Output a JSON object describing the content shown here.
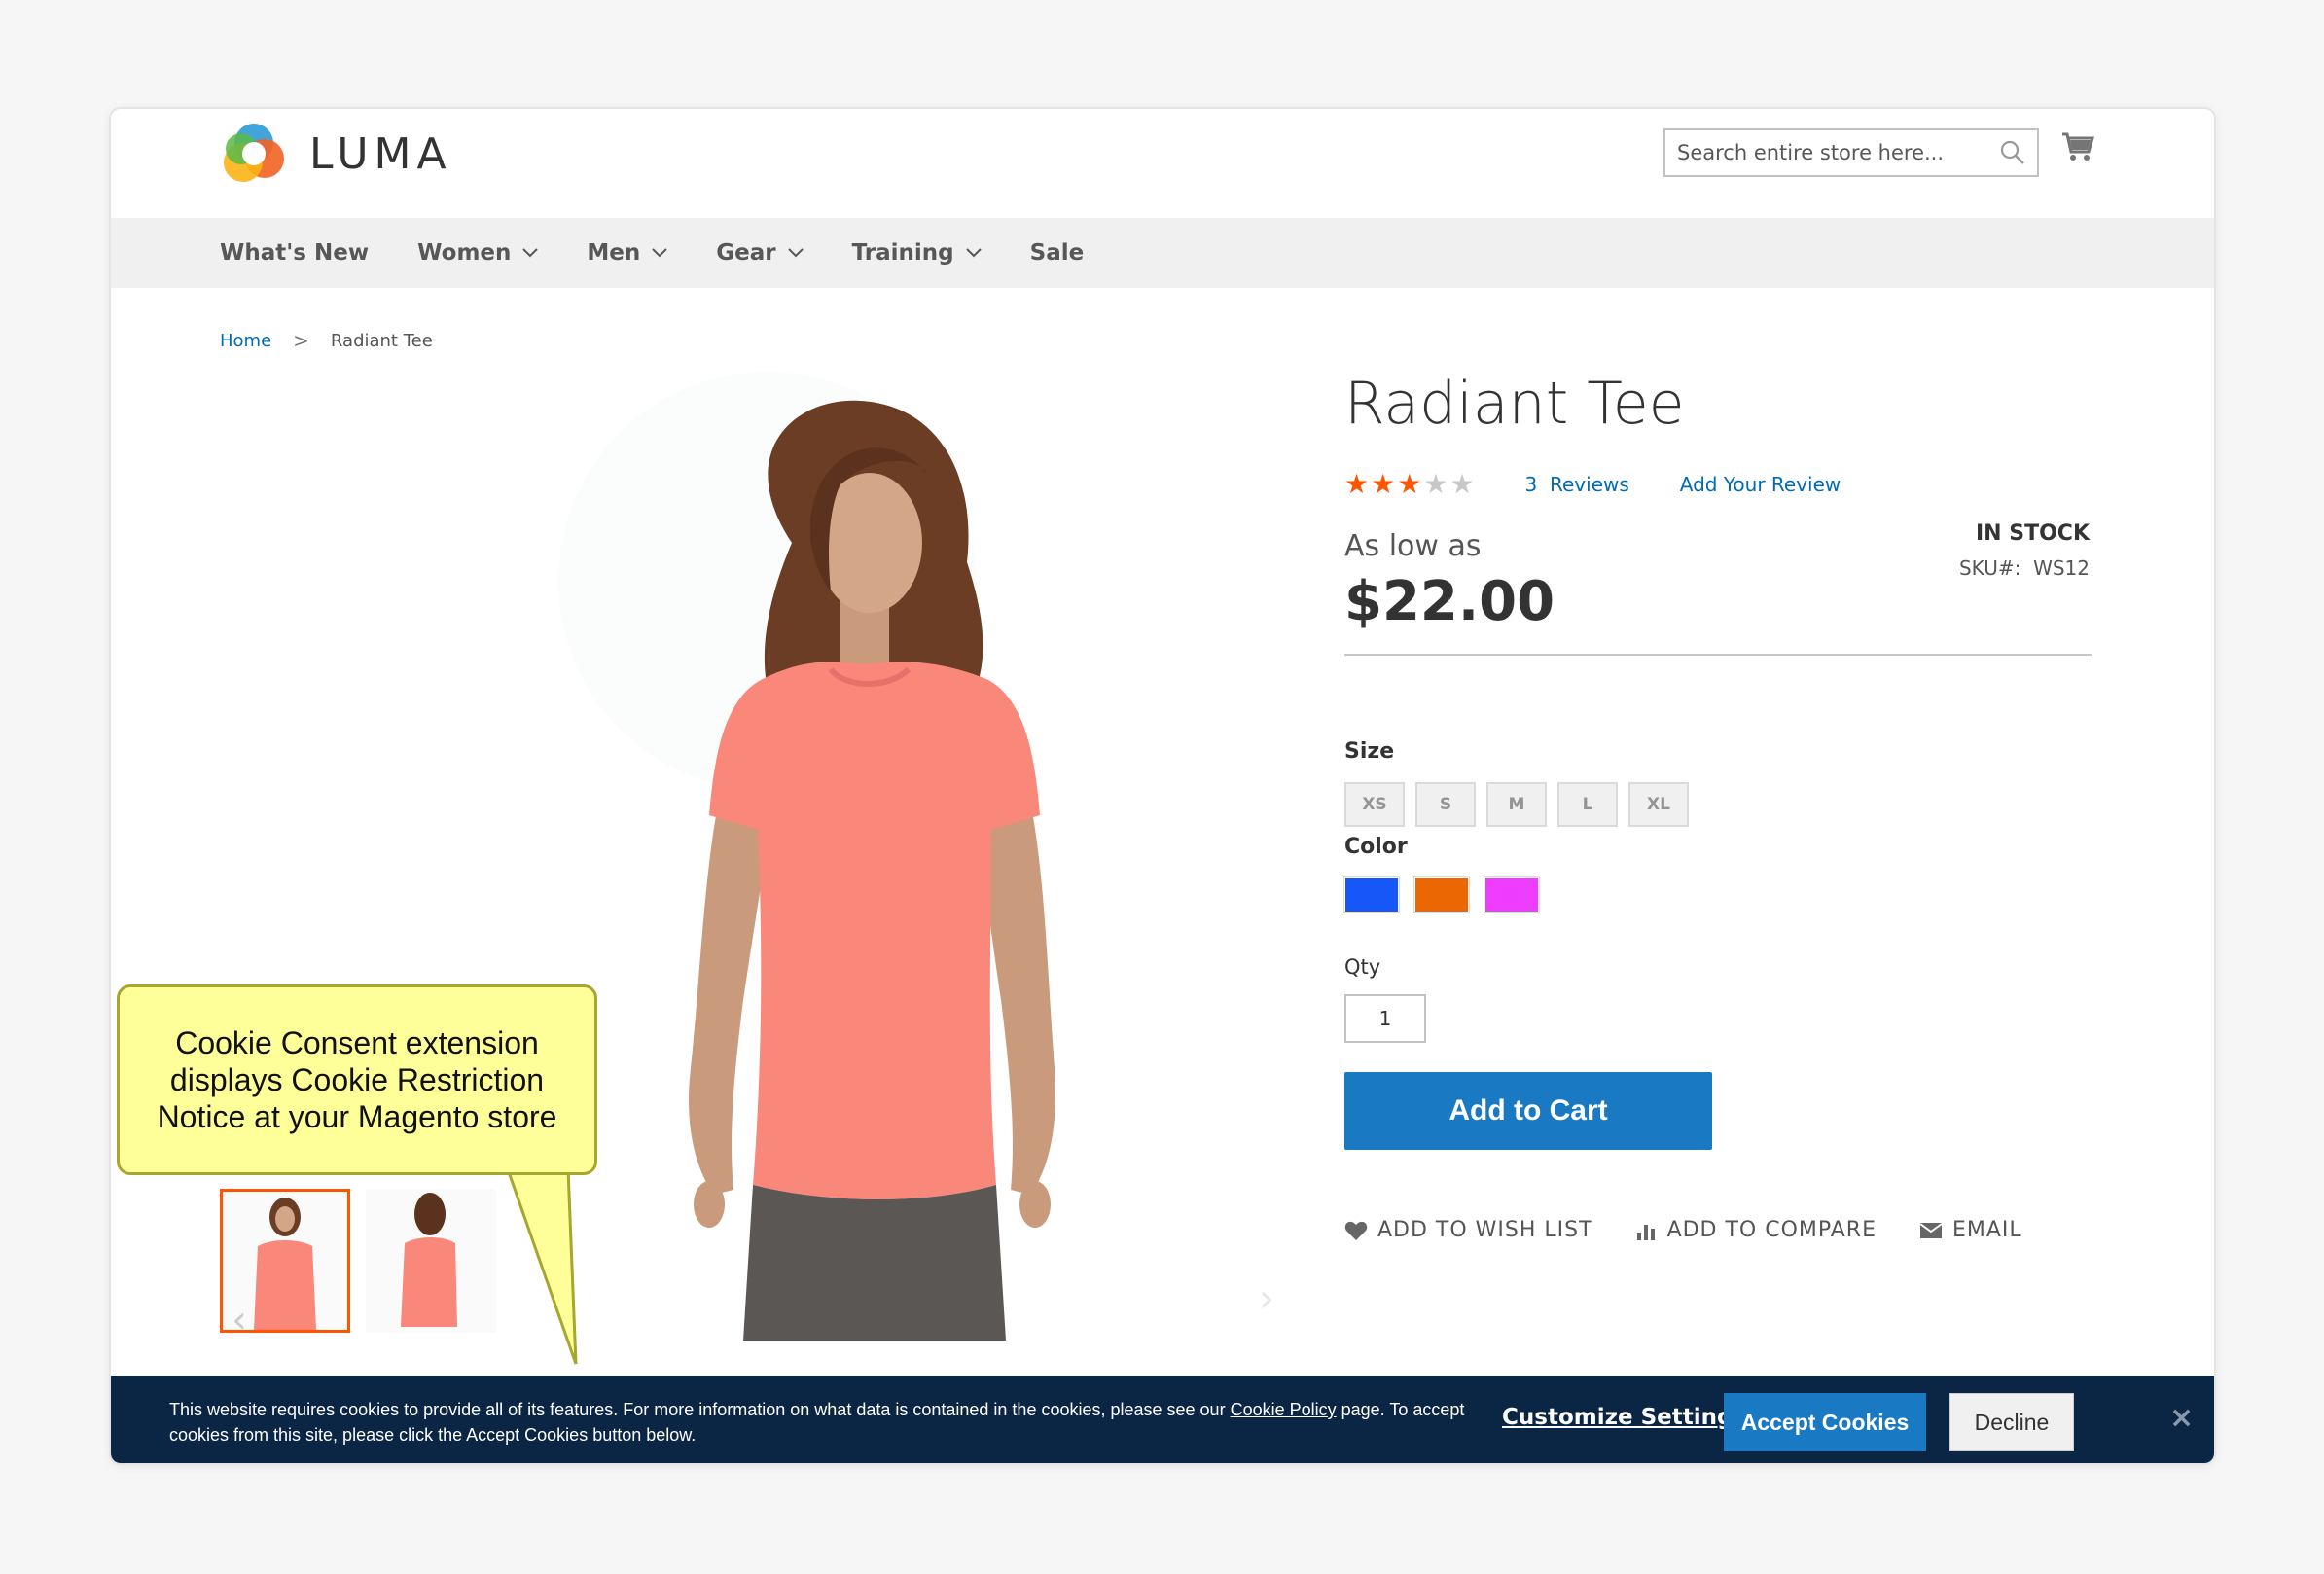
{
  "header": {
    "logo_text": "LUMA",
    "search_placeholder": "Search entire store here..."
  },
  "nav": {
    "items": [
      {
        "label": "What's New",
        "dropdown": false
      },
      {
        "label": "Women",
        "dropdown": true
      },
      {
        "label": "Men",
        "dropdown": true
      },
      {
        "label": "Gear",
        "dropdown": true
      },
      {
        "label": "Training",
        "dropdown": true
      },
      {
        "label": "Sale",
        "dropdown": false
      }
    ]
  },
  "breadcrumb": {
    "home": "Home",
    "separator": ">",
    "current": "Radiant Tee"
  },
  "product": {
    "title": "Radiant Tee",
    "rating_stars": 3,
    "rating_max": 5,
    "reviews_count": "3",
    "reviews_label": "Reviews",
    "add_review": "Add Your Review",
    "as_low_as": "As low as",
    "price": "$22.00",
    "stock": "IN STOCK",
    "sku_label": "SKU#:",
    "sku_value": "WS12",
    "size_label": "Size",
    "sizes": [
      "XS",
      "S",
      "M",
      "L",
      "XL"
    ],
    "color_label": "Color",
    "colors": [
      "#1857f7",
      "#eb6703",
      "#ef3dff"
    ],
    "qty_label": "Qty",
    "qty_value": "1",
    "add_to_cart": "Add to Cart",
    "wishlist": "ADD TO WISH LIST",
    "compare": "ADD TO COMPARE",
    "email": "EMAIL"
  },
  "callout": {
    "line1": "Cookie Consent extension",
    "line2": "displays Cookie Restriction",
    "line3": "Notice at your Magento store"
  },
  "cookie": {
    "text_before": "This website requires cookies to provide all of its features. For more information on what data is contained in the cookies, please see our ",
    "policy_link": "Cookie Policy",
    "text_after": " page. To accept cookies from this site, please click the Accept Cookies button below.",
    "customize": "Customize Settings",
    "accept": "Accept Cookies",
    "decline": "Decline",
    "close": "×"
  },
  "colors": {
    "accent": "#1979c3",
    "link": "#006bb4",
    "star": "#ff5501",
    "cookie_bar": "#0b2545",
    "callout_bg": "#ffff99"
  }
}
